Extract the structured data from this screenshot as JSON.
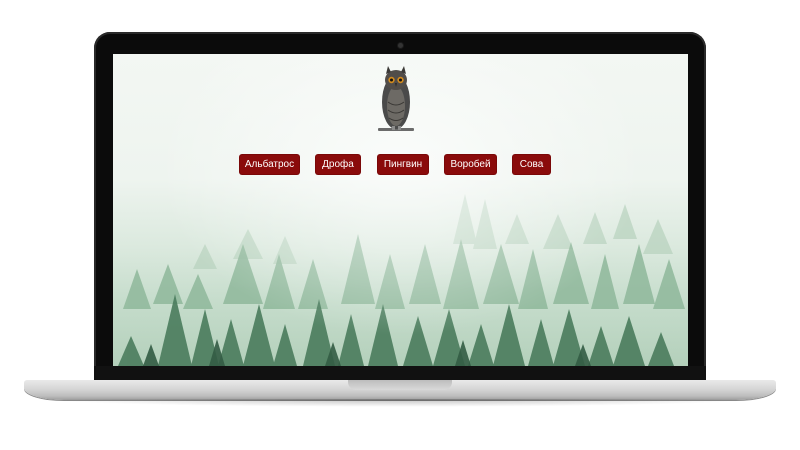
{
  "nav": {
    "items": [
      {
        "label": "Альбатрос"
      },
      {
        "label": "Дрофа"
      },
      {
        "label": "Пингвин"
      },
      {
        "label": "Воробей"
      },
      {
        "label": "Сова"
      }
    ]
  },
  "colors": {
    "button_bg": "#8a0b0b",
    "button_text": "#ffffff",
    "bezel": "#0b0b0b",
    "chassis": "#d6d6d6",
    "forest_dark": "#3f6e52",
    "forest_light": "#9cc2a6"
  },
  "icons": {
    "hero_image": "owl-icon",
    "background": "misty-forest-image"
  }
}
